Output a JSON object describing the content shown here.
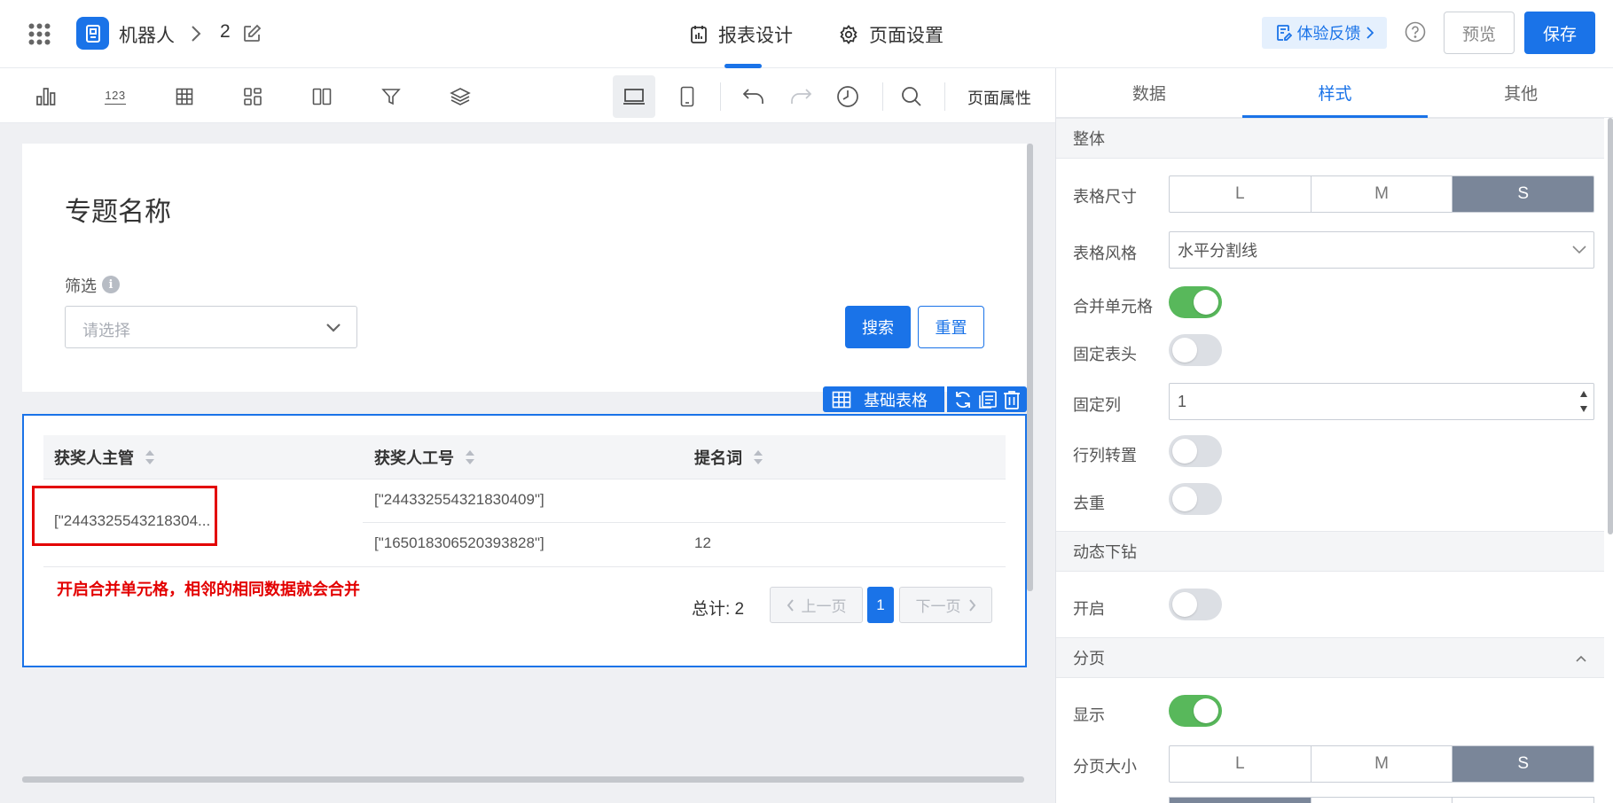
{
  "header": {
    "app_name": "机器人",
    "page_number": "2",
    "nav": [
      {
        "label": "报表设计",
        "active": true
      },
      {
        "label": "页面设置",
        "active": false
      }
    ],
    "feedback_label": "体验反馈",
    "preview_label": "预览",
    "save_label": "保存",
    "accent_color": "#1a73e8"
  },
  "toolbar": {
    "tools": [
      "bar-chart-icon",
      "number-icon",
      "table-icon",
      "grid-icon",
      "columns-icon",
      "filter-icon",
      "layers-icon"
    ],
    "number_tool_label": "123",
    "page_props_label": "页面属性"
  },
  "canvas": {
    "page_title": "专题名称",
    "filter_label": "筛选",
    "select_placeholder": "请选择",
    "search_label": "搜索",
    "reset_label": "重置",
    "component_label": "基础表格",
    "table": {
      "headers": [
        "获奖人主管",
        "获奖人工号",
        "提名词"
      ],
      "merged_cell": "[\"2443325543218304...",
      "rows": [
        {
          "col2": "[\"244332554321830409\"]",
          "col3": ""
        },
        {
          "col2": "[\"165018306520393828\"]",
          "col3": "12"
        }
      ]
    },
    "note": "开启合并单元格，相邻的相同数据就会合并",
    "note_color": "#e30000",
    "pagination": {
      "total_label": "总计: 2",
      "prev_label": "上一页",
      "current_page": "1",
      "next_label": "下一页"
    }
  },
  "panel": {
    "tabs": [
      {
        "label": "数据",
        "active": false
      },
      {
        "label": "样式",
        "active": true
      },
      {
        "label": "其他",
        "active": false
      }
    ],
    "section_overall": "整体",
    "table_size_label": "表格尺寸",
    "table_size_options": [
      "L",
      "M",
      "S"
    ],
    "table_size_selected": "S",
    "table_style_label": "表格风格",
    "table_style_value": "水平分割线",
    "merge_cells_label": "合并单元格",
    "merge_cells_on": true,
    "fixed_header_label": "固定表头",
    "fixed_header_on": false,
    "fixed_column_label": "固定列",
    "fixed_column_value": "1",
    "transpose_label": "行列转置",
    "transpose_on": false,
    "dedupe_label": "去重",
    "dedupe_on": false,
    "section_drill": "动态下钻",
    "drill_enable_label": "开启",
    "drill_enable_on": false,
    "section_paging": "分页",
    "paging_show_label": "显示",
    "paging_show_on": true,
    "page_size_label": "分页大小",
    "page_size_options": [
      "L",
      "M",
      "S"
    ],
    "page_size_selected": "S",
    "switch_on_color": "#58b85b"
  }
}
